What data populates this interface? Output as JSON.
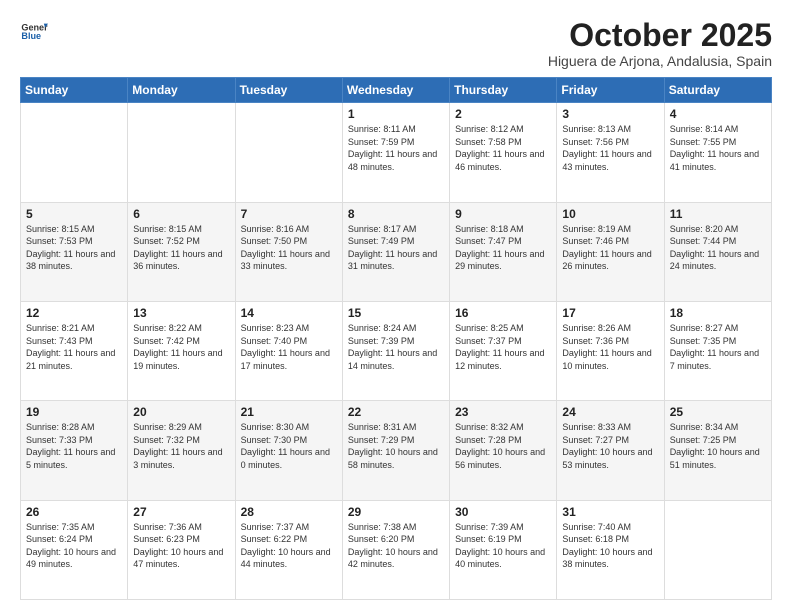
{
  "logo": {
    "general": "General",
    "blue": "Blue"
  },
  "header": {
    "month": "October 2025",
    "location": "Higuera de Arjona, Andalusia, Spain"
  },
  "days_of_week": [
    "Sunday",
    "Monday",
    "Tuesday",
    "Wednesday",
    "Thursday",
    "Friday",
    "Saturday"
  ],
  "weeks": [
    [
      {
        "day": "",
        "info": ""
      },
      {
        "day": "",
        "info": ""
      },
      {
        "day": "",
        "info": ""
      },
      {
        "day": "1",
        "info": "Sunrise: 8:11 AM\nSunset: 7:59 PM\nDaylight: 11 hours and 48 minutes."
      },
      {
        "day": "2",
        "info": "Sunrise: 8:12 AM\nSunset: 7:58 PM\nDaylight: 11 hours and 46 minutes."
      },
      {
        "day": "3",
        "info": "Sunrise: 8:13 AM\nSunset: 7:56 PM\nDaylight: 11 hours and 43 minutes."
      },
      {
        "day": "4",
        "info": "Sunrise: 8:14 AM\nSunset: 7:55 PM\nDaylight: 11 hours and 41 minutes."
      }
    ],
    [
      {
        "day": "5",
        "info": "Sunrise: 8:15 AM\nSunset: 7:53 PM\nDaylight: 11 hours and 38 minutes."
      },
      {
        "day": "6",
        "info": "Sunrise: 8:15 AM\nSunset: 7:52 PM\nDaylight: 11 hours and 36 minutes."
      },
      {
        "day": "7",
        "info": "Sunrise: 8:16 AM\nSunset: 7:50 PM\nDaylight: 11 hours and 33 minutes."
      },
      {
        "day": "8",
        "info": "Sunrise: 8:17 AM\nSunset: 7:49 PM\nDaylight: 11 hours and 31 minutes."
      },
      {
        "day": "9",
        "info": "Sunrise: 8:18 AM\nSunset: 7:47 PM\nDaylight: 11 hours and 29 minutes."
      },
      {
        "day": "10",
        "info": "Sunrise: 8:19 AM\nSunset: 7:46 PM\nDaylight: 11 hours and 26 minutes."
      },
      {
        "day": "11",
        "info": "Sunrise: 8:20 AM\nSunset: 7:44 PM\nDaylight: 11 hours and 24 minutes."
      }
    ],
    [
      {
        "day": "12",
        "info": "Sunrise: 8:21 AM\nSunset: 7:43 PM\nDaylight: 11 hours and 21 minutes."
      },
      {
        "day": "13",
        "info": "Sunrise: 8:22 AM\nSunset: 7:42 PM\nDaylight: 11 hours and 19 minutes."
      },
      {
        "day": "14",
        "info": "Sunrise: 8:23 AM\nSunset: 7:40 PM\nDaylight: 11 hours and 17 minutes."
      },
      {
        "day": "15",
        "info": "Sunrise: 8:24 AM\nSunset: 7:39 PM\nDaylight: 11 hours and 14 minutes."
      },
      {
        "day": "16",
        "info": "Sunrise: 8:25 AM\nSunset: 7:37 PM\nDaylight: 11 hours and 12 minutes."
      },
      {
        "day": "17",
        "info": "Sunrise: 8:26 AM\nSunset: 7:36 PM\nDaylight: 11 hours and 10 minutes."
      },
      {
        "day": "18",
        "info": "Sunrise: 8:27 AM\nSunset: 7:35 PM\nDaylight: 11 hours and 7 minutes."
      }
    ],
    [
      {
        "day": "19",
        "info": "Sunrise: 8:28 AM\nSunset: 7:33 PM\nDaylight: 11 hours and 5 minutes."
      },
      {
        "day": "20",
        "info": "Sunrise: 8:29 AM\nSunset: 7:32 PM\nDaylight: 11 hours and 3 minutes."
      },
      {
        "day": "21",
        "info": "Sunrise: 8:30 AM\nSunset: 7:30 PM\nDaylight: 11 hours and 0 minutes."
      },
      {
        "day": "22",
        "info": "Sunrise: 8:31 AM\nSunset: 7:29 PM\nDaylight: 10 hours and 58 minutes."
      },
      {
        "day": "23",
        "info": "Sunrise: 8:32 AM\nSunset: 7:28 PM\nDaylight: 10 hours and 56 minutes."
      },
      {
        "day": "24",
        "info": "Sunrise: 8:33 AM\nSunset: 7:27 PM\nDaylight: 10 hours and 53 minutes."
      },
      {
        "day": "25",
        "info": "Sunrise: 8:34 AM\nSunset: 7:25 PM\nDaylight: 10 hours and 51 minutes."
      }
    ],
    [
      {
        "day": "26",
        "info": "Sunrise: 7:35 AM\nSunset: 6:24 PM\nDaylight: 10 hours and 49 minutes."
      },
      {
        "day": "27",
        "info": "Sunrise: 7:36 AM\nSunset: 6:23 PM\nDaylight: 10 hours and 47 minutes."
      },
      {
        "day": "28",
        "info": "Sunrise: 7:37 AM\nSunset: 6:22 PM\nDaylight: 10 hours and 44 minutes."
      },
      {
        "day": "29",
        "info": "Sunrise: 7:38 AM\nSunset: 6:20 PM\nDaylight: 10 hours and 42 minutes."
      },
      {
        "day": "30",
        "info": "Sunrise: 7:39 AM\nSunset: 6:19 PM\nDaylight: 10 hours and 40 minutes."
      },
      {
        "day": "31",
        "info": "Sunrise: 7:40 AM\nSunset: 6:18 PM\nDaylight: 10 hours and 38 minutes."
      },
      {
        "day": "",
        "info": ""
      }
    ]
  ]
}
